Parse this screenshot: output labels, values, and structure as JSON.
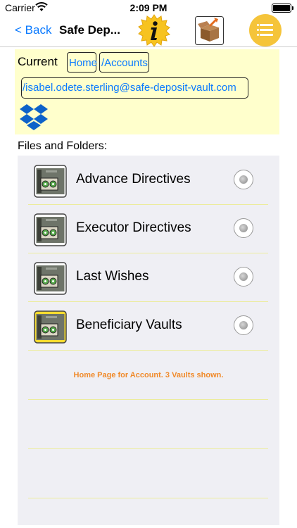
{
  "status_bar": {
    "carrier": "Carrier",
    "time": "2:09 PM"
  },
  "nav": {
    "back_label": "< Back",
    "title": "Safe Dep...",
    "icons": {
      "info": "info-icon",
      "box": "package-icon",
      "menu": "list-menu-icon"
    }
  },
  "location": {
    "current_label": "Current",
    "crumbs": [
      "Home",
      "/Accounts"
    ],
    "account_path": "/isabel.odete.sterling@safe-deposit-vault.com",
    "dropbox_icon": "dropbox-icon"
  },
  "files_label": "Files and Folders:",
  "items": [
    {
      "label": "Advance Directives",
      "icon": "safe-icon",
      "highlighted": false
    },
    {
      "label": "Executor Directives",
      "icon": "safe-icon",
      "highlighted": false
    },
    {
      "label": "Last Wishes",
      "icon": "safe-icon",
      "highlighted": false
    },
    {
      "label": "Beneficiary Vaults",
      "icon": "safe-icon",
      "highlighted": true
    }
  ],
  "status_message": "Home Page for Account. 3 Vaults shown.",
  "colors": {
    "accent": "#0a7aff",
    "panel": "#ffffcc",
    "list_bg": "#efeff4",
    "menu": "#f5c43a",
    "message": "#f08a2a"
  }
}
